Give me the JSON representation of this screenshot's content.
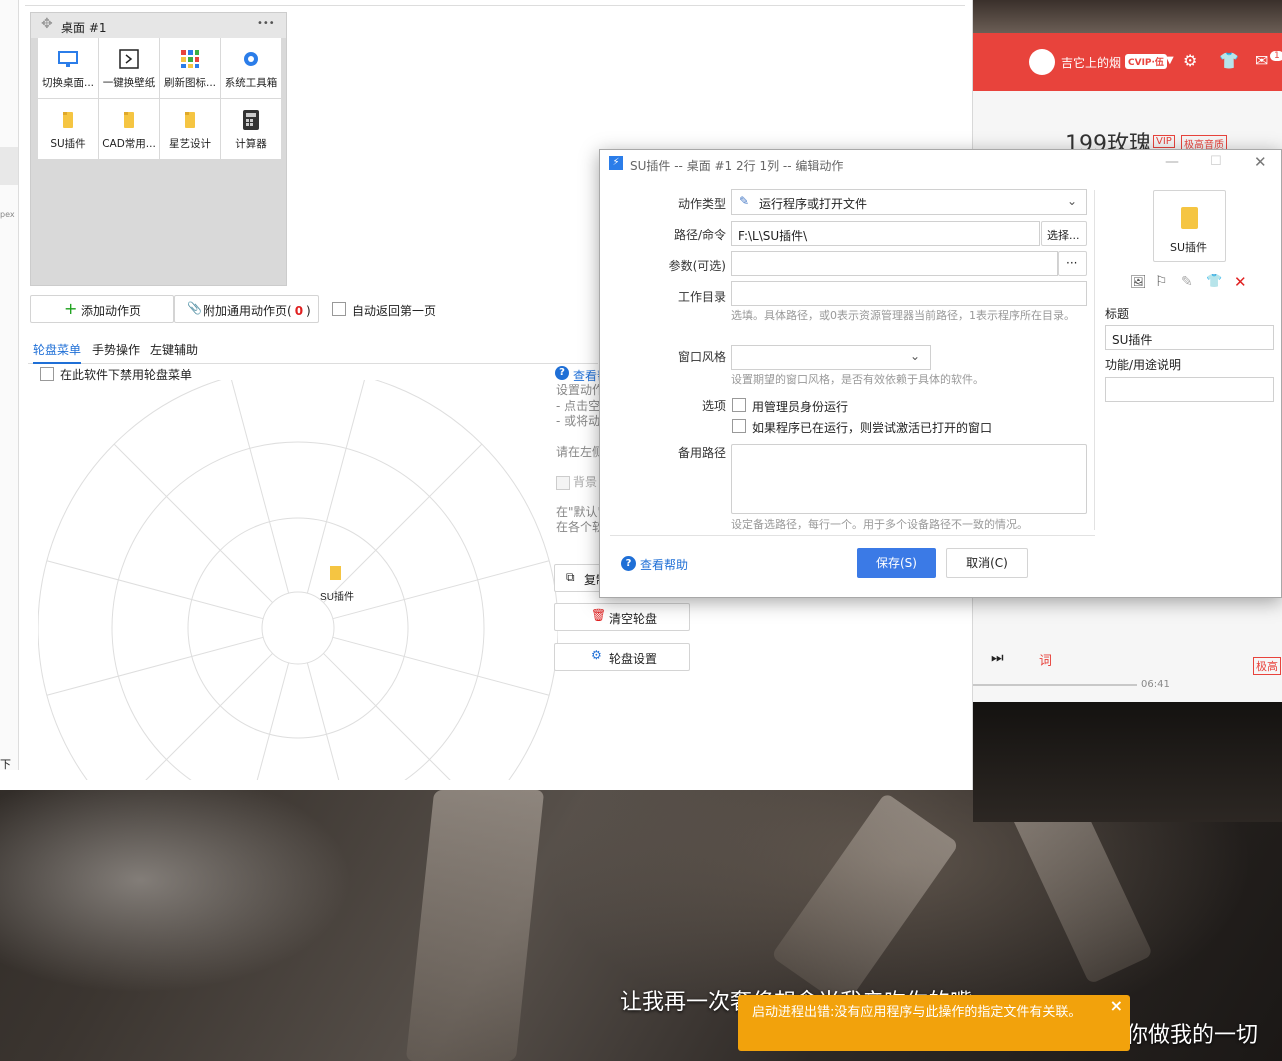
{
  "video": {
    "subtitle_1": "让我再一次奢侈想念当我亲吻你的嘴",
    "subtitle_2": "你做我的一切"
  },
  "music_player": {
    "user_name": "吉它上的烟",
    "vip_badge": "CVIP·伍",
    "mail_count": "1",
    "song_title": "199玫瑰",
    "tag_vip": "VIP",
    "tag_quality": "极高音质",
    "lyrics_icon": "词",
    "time": "06:41",
    "quality_badge": "极高"
  },
  "app": {
    "left_strip_text": "pex",
    "left_strip_bottom": "下",
    "desktop": {
      "title": "桌面 #1",
      "menu": "•••",
      "items": [
        {
          "label": "切换桌面...",
          "icon": "monitor-icon"
        },
        {
          "label": "一键换壁纸",
          "icon": "terminal-icon"
        },
        {
          "label": "刷新图标...",
          "icon": "grid-icon"
        },
        {
          "label": "系统工具箱",
          "icon": "gear-icon"
        },
        {
          "label": "SU插件",
          "icon": "folder-icon"
        },
        {
          "label": "CAD常用...",
          "icon": "folder-icon"
        },
        {
          "label": "星艺设计",
          "icon": "folder-icon"
        },
        {
          "label": "计算器",
          "icon": "calculator-icon"
        }
      ]
    },
    "add_page": "添加动作页",
    "attach_page": "附加通用动作页(",
    "attach_count": "0",
    "attach_close": ")",
    "auto_return": "自动返回第一页",
    "tabs": [
      "轮盘菜单",
      "手势操作",
      "左键辅助"
    ],
    "disable_wheel": "在此软件下禁用轮盘菜单",
    "wheel_item": "SU插件",
    "help": {
      "link": "查看帮",
      "line1": "设置动作",
      "line2": "- 点击空",
      "line3": "- 或将动",
      "line4": "请在左侧",
      "line5": "背景",
      "line6": "在\"默认\"",
      "line7": "在各个软"
    },
    "copy_btn": "复制",
    "clear_btn": "清空轮盘",
    "settings_btn": "轮盘设置"
  },
  "dialog": {
    "title": "SU插件 -- 桌面 #1 2行 1列 -- 编辑动作",
    "action_type_label": "动作类型",
    "action_type_value": "运行程序或打开文件",
    "path_label": "路径/命令",
    "path_value": "F:\\L\\SU插件\\",
    "choose_btn": "选择...",
    "params_label": "参数(可选)",
    "more_btn": "···",
    "workdir_label": "工作目录",
    "workdir_hint": "选填。具体路径，或0表示资源管理器当前路径，1表示程序所在目录。",
    "window_style_label": "窗口风格",
    "window_style_hint": "设置期望的窗口风格，是否有效依赖于具体的软件。",
    "options_label": "选项",
    "opt_admin": "用管理员身份运行",
    "opt_activate": "如果程序已在运行，则尝试激活已打开的窗口",
    "backup_label": "备用路径",
    "backup_hint": "设定备选路径，每行一个。用于多个设备路径不一致的情况。",
    "help_link": "查看帮助",
    "save_btn": "保存(S)",
    "cancel_btn": "取消(C)",
    "preview_label": "SU插件",
    "title_label": "标题",
    "title_value": "SU插件",
    "desc_label": "功能/用途说明"
  },
  "toast": {
    "message": "启动进程出错:没有应用程序与此操作的指定文件有关联。",
    "close": "×"
  }
}
